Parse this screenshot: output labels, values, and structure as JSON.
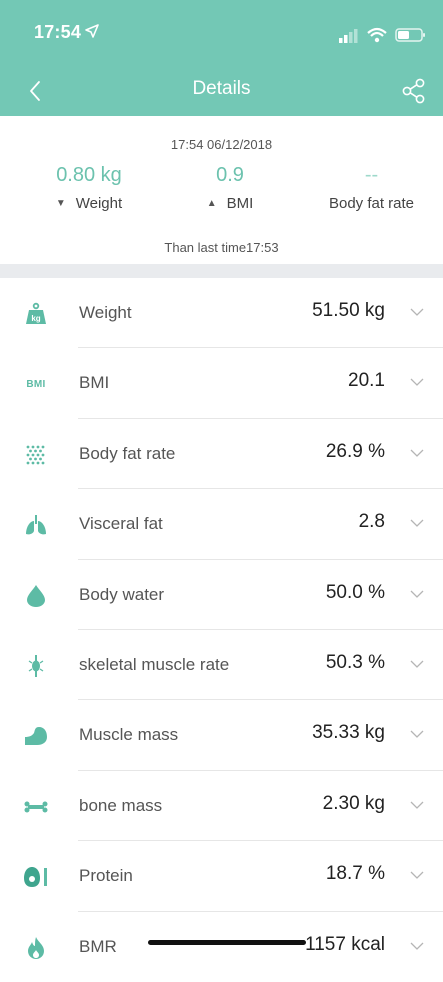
{
  "status_bar": {
    "time": "17:54"
  },
  "nav": {
    "title": "Details"
  },
  "summary": {
    "datetime": "17:54 06/12/2018",
    "comparisons": [
      {
        "value": "0.80 kg",
        "label": "Weight",
        "direction": "down"
      },
      {
        "value": "0.9",
        "label": "BMI",
        "direction": "up"
      },
      {
        "value": "--",
        "label": "Body fat rate",
        "direction": "none"
      }
    ],
    "than_last": "Than last time17:53"
  },
  "metrics": [
    {
      "label": "Weight",
      "value": "51.50 kg",
      "icon": "weight-kg-icon"
    },
    {
      "label": "BMI",
      "value": "20.1",
      "icon": "bmi-icon"
    },
    {
      "label": "Body fat rate",
      "value": "26.9 %",
      "icon": "body-fat-icon"
    },
    {
      "label": "Visceral fat",
      "value": "2.8",
      "icon": "lungs-icon"
    },
    {
      "label": "Body water",
      "value": "50.0 %",
      "icon": "water-drop-icon"
    },
    {
      "label": "skeletal muscle rate",
      "value": "50.3 %",
      "icon": "skeletal-muscle-icon"
    },
    {
      "label": "Muscle mass",
      "value": "35.33 kg",
      "icon": "bicep-icon"
    },
    {
      "label": "bone mass",
      "value": "2.30 kg",
      "icon": "bone-icon"
    },
    {
      "label": "Protein",
      "value": "18.7 %",
      "icon": "protein-icon"
    },
    {
      "label": "BMR",
      "value": "1157 kcal",
      "icon": "flame-icon"
    }
  ],
  "bmi_icon_text": "BMI",
  "weight_icon_text": "kg",
  "colors": {
    "accent": "#73c8b5",
    "value_accent": "#6cc2ae"
  }
}
